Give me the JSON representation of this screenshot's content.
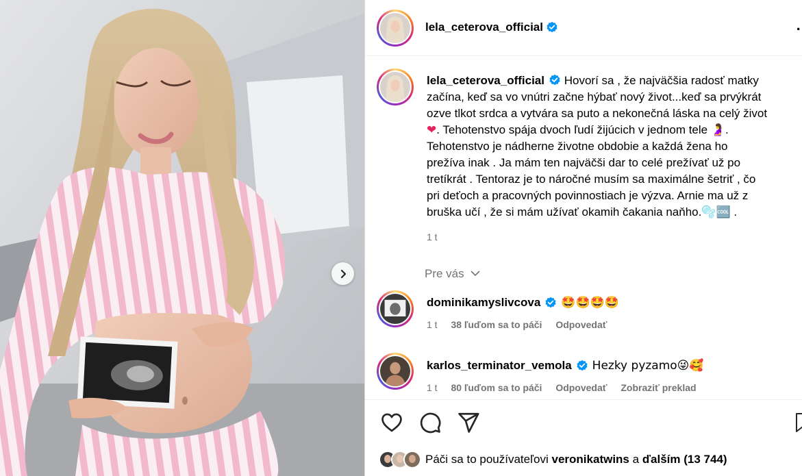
{
  "post": {
    "author": "lela_ceterova_official",
    "caption": "Hovorí sa , že najväčšia radosť matky začína, keď sa vo vnútri začne hýbať nový život...keď sa prvýkrát ozve tlkot srdca a vytvára sa puto a nekonečná láska na celý život ❤️. Tehotenstvo spája dvoch ľudí žijúcich v jednom tele 🤰. Tehotenstvo je nádherne životne obdobie a každá žena ho prežíva inak . Ja mám ten najväčši dar to celé prežívať už po tretíkrát . Tentoraz je to náročné musím sa maximálne šetriť , čo pri deťoch a pracovných povinnostiach je výzva. Arnie ma už z bruška učí , že si mám užívať okamih čakania naňho.🫧🆒 .",
    "caption_lines": [
      "Hovorí sa , že najväčšia radosť matky",
      "začína, keď sa vo vnútri začne hýbať nový život...keď sa prvýkrát",
      "ozve tlkot srdca a vytvára sa puto a nekonečná láska na celý život",
      ". Tehotenstvo spája dvoch ľudí žijúcich v jednom tele",
      "Tehotenstvo je nádherne životne obdobie a každá žena ho",
      "prežíva inak . Ja mám ten najväčši dar to celé prežívať už po",
      "tretíkrát . Tentoraz je to náročné musím sa maximálne šetriť , čo",
      "pri deťoch a pracovných povinnostiach je výzva. Arnie ma už z",
      "bruška učí , že si mám užívať okamih čakania naňho.",
      " ."
    ],
    "time": "1 t"
  },
  "pre_vas": "Pre vás",
  "comments": [
    {
      "username": "dominikamyslivcova",
      "text": "🤩🤩🤩🤩",
      "time": "1 t",
      "likes": "38 ľuďom sa to páči",
      "reply": "Odpovedať"
    },
    {
      "username": "karlos_terminator_vemola",
      "text": "Hezky pyzamo😜🥰",
      "time": "1 t",
      "likes": "80 ľuďom sa to páči",
      "reply": "Odpovedať",
      "translate": "Zobraziť preklad"
    }
  ],
  "likes_summary": {
    "prefix": "Páči sa to používateľovi",
    "user": "veronikatwins",
    "joiner": "a",
    "rest": "ďalším (13 744)"
  },
  "colors": {
    "verified": "#0095f6",
    "muted": "#737373",
    "stripe_pink": "#f2b8cc"
  },
  "icons": [
    "verified-icon",
    "more-icon",
    "heart-icon",
    "comment-icon",
    "share-icon",
    "bookmark-icon",
    "chevron-right-icon",
    "chevron-down-icon"
  ]
}
